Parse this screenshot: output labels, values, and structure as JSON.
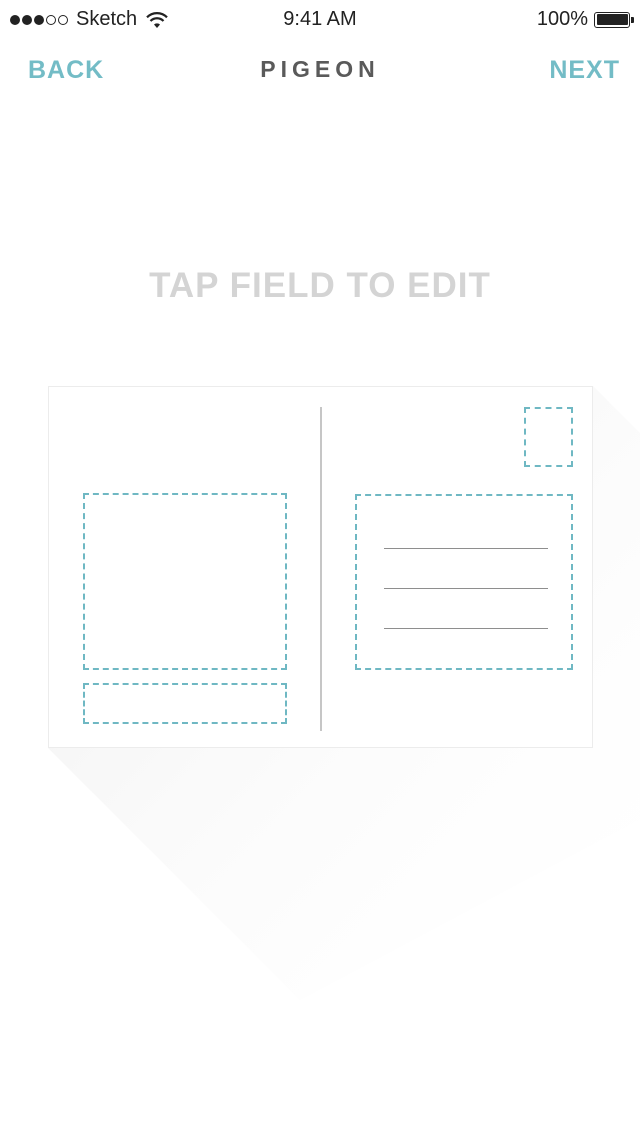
{
  "status_bar": {
    "carrier": "Sketch",
    "time": "9:41 AM",
    "battery": "100%",
    "signal_bars_filled": 3,
    "signal_bars_total": 5
  },
  "nav": {
    "back_label": "BACK",
    "title": "PIGEON",
    "next_label": "NEXT"
  },
  "instruction": "TAP FIELD TO EDIT",
  "colors": {
    "accent": "#73bcc6",
    "title": "#5a5a5a",
    "instruction": "#d4d4d4",
    "field_border": "#6fb8c3"
  },
  "icons": {
    "wifi": "wifi-icon",
    "battery": "battery-icon",
    "signal": "signal-strength-icon"
  }
}
